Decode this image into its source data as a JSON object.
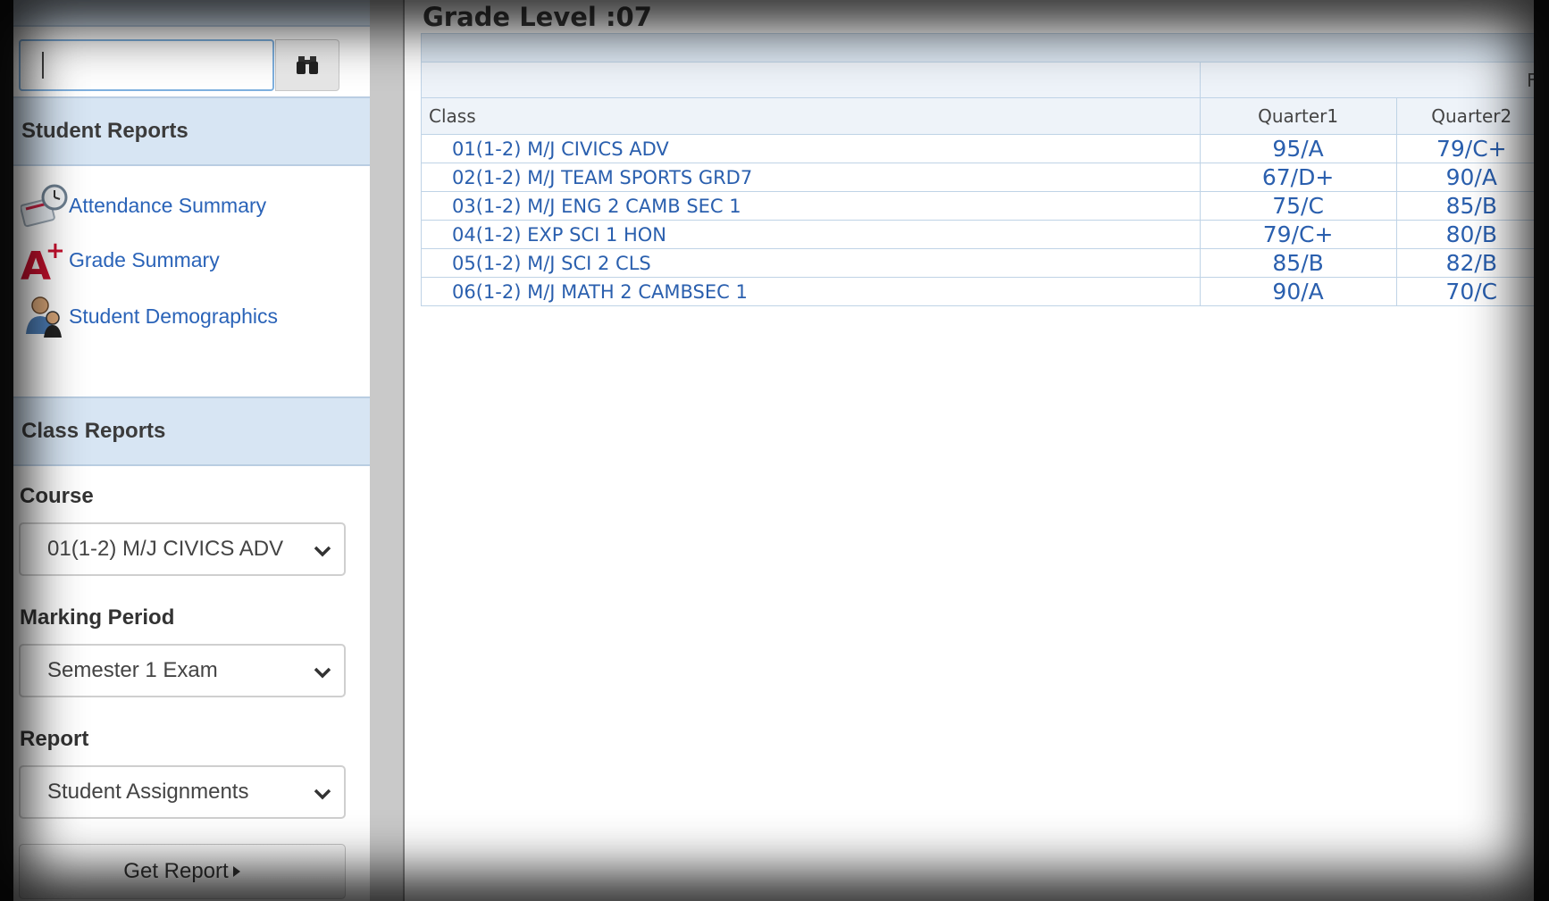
{
  "search": {
    "value": "",
    "button_icon": "binoculars-icon"
  },
  "student_reports": {
    "title": "Student Reports",
    "links": [
      {
        "label": "Attendance Summary",
        "icon": "clock-calendar-icon"
      },
      {
        "label": "Grade Summary",
        "icon": "a-plus-icon"
      },
      {
        "label": "Student Demographics",
        "icon": "people-icon"
      }
    ]
  },
  "class_reports": {
    "title": "Class Reports",
    "course_label": "Course",
    "course_value": "01(1-2) M/J CIVICS ADV",
    "marking_period_label": "Marking Period",
    "marking_period_value": "Semester 1 Exam",
    "report_label": "Report",
    "report_value": "Student Assignments",
    "get_report_label": "Get Report"
  },
  "main": {
    "grade_level": "Grade Level :07",
    "group_header_partial": "Fa",
    "columns": [
      "Class",
      "Quarter1",
      "Quarter2"
    ],
    "rows": [
      {
        "class": "01(1-2) M/J CIVICS ADV",
        "q1": "95/A",
        "q2": "79/C+"
      },
      {
        "class": "02(1-2) M/J TEAM SPORTS GRD7",
        "q1": "67/D+",
        "q2": "90/A"
      },
      {
        "class": "03(1-2) M/J ENG 2 CAMB SEC 1",
        "q1": "75/C",
        "q2": "85/B"
      },
      {
        "class": "04(1-2) EXP SCI 1 HON",
        "q1": "79/C+",
        "q2": "80/B"
      },
      {
        "class": "05(1-2) M/J SCI 2 CLS",
        "q1": "85/B",
        "q2": "82/B"
      },
      {
        "class": "06(1-2) M/J MATH 2 CAMBSEC 1",
        "q1": "90/A",
        "q2": "70/C"
      }
    ]
  },
  "colors": {
    "link": "#2a63b8",
    "header_band": "#d7e5f3",
    "grade_text": "#2a5fae"
  }
}
